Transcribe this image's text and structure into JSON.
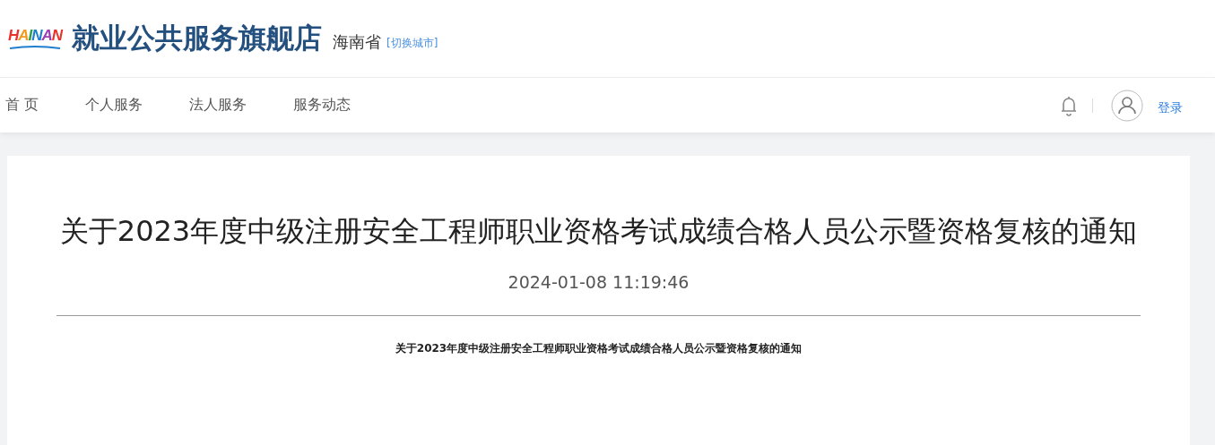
{
  "header": {
    "logo": "HAINAN",
    "title": "就业公共服务旗舰店",
    "province": "海南省",
    "switch_city": "[切换城市]"
  },
  "nav": {
    "items": [
      {
        "label": "首 页",
        "selected": false
      },
      {
        "label": "个人服务",
        "selected": false
      },
      {
        "label": "法人服务",
        "selected": false
      },
      {
        "label": "服务动态",
        "selected": false
      }
    ],
    "login": "登录"
  },
  "article": {
    "title": "关于2023年度中级注册安全工程师职业资格考试成绩合格人员公示暨资格复核的通知",
    "date": "2024-01-08 11:19:46",
    "body_heading": "关于2023年度中级注册安全工程师职业资格考试成绩合格人员公示暨资格复核的通知"
  }
}
